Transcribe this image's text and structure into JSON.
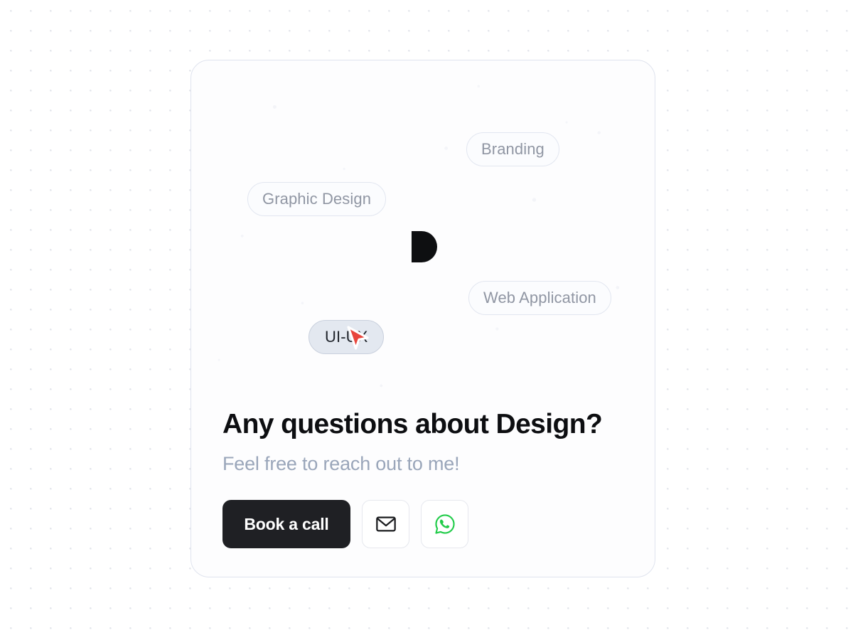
{
  "background": {
    "pattern": "dot-grid",
    "dot_color": "#e4e6ec",
    "page_color": "#ffffff"
  },
  "card": {
    "background_color": "#fdfdfe",
    "border_color": "#dfe3ee",
    "logo_icon": "d-logo-icon",
    "logo_color": "#0e0f11",
    "heading": "Any questions about Design?",
    "subheading": "Feel free to reach out to me!",
    "heading_color": "#0d0e11",
    "subheading_color": "#9aa6ba",
    "tags": [
      {
        "label": "Branding",
        "active": false
      },
      {
        "label": "Graphic Design",
        "active": false
      },
      {
        "label": "Web Application",
        "active": false
      },
      {
        "label": "UI-UX",
        "active": true
      }
    ],
    "actions": {
      "primary_label": "Book a call",
      "primary_bg": "#1f2024",
      "primary_text_color": "#ffffff",
      "email_icon": "envelope-icon",
      "email_icon_color": "#1b1c1f",
      "whatsapp_icon": "whatsapp-icon",
      "whatsapp_icon_color": "#22cc4a"
    }
  },
  "cursor": {
    "icon": "mouse-pointer-arrow-icon",
    "fill_color": "#e8453c",
    "outline_color": "#ffffff"
  }
}
